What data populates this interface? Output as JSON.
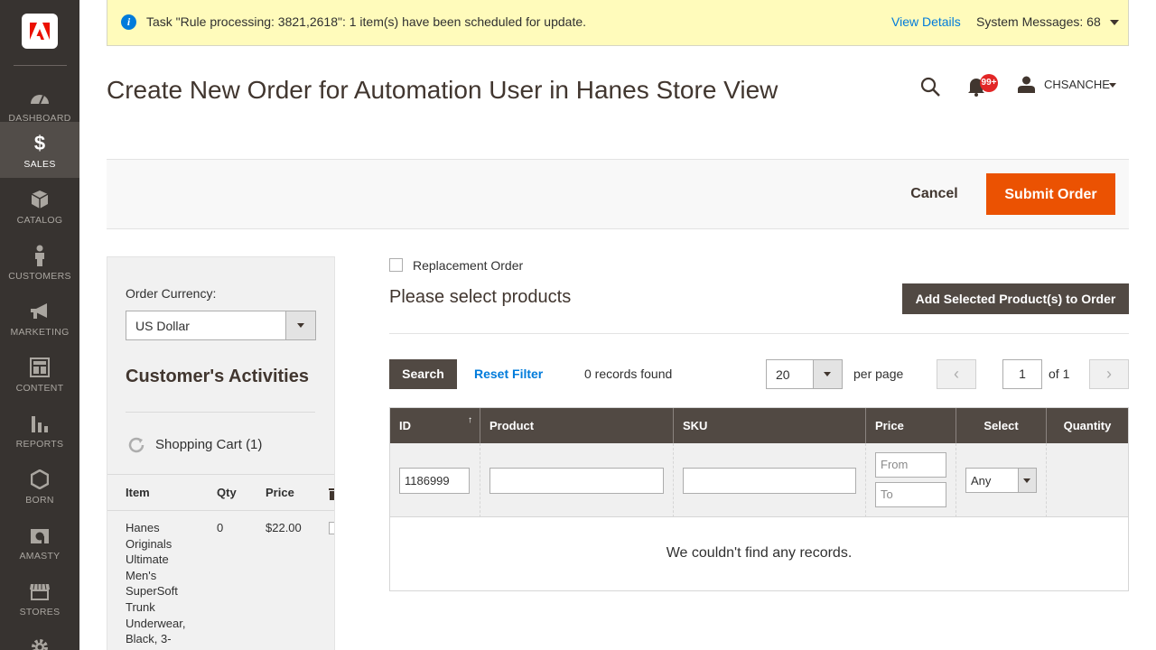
{
  "sidebar": {
    "logo_icon": "adobe-logo-icon",
    "items": [
      {
        "label": "DASHBOARD",
        "icon": "dashboard-gauge-icon"
      },
      {
        "label": "SALES",
        "icon": "dollar-icon",
        "active": true
      },
      {
        "label": "CATALOG",
        "icon": "box-icon"
      },
      {
        "label": "CUSTOMERS",
        "icon": "person-icon"
      },
      {
        "label": "MARKETING",
        "icon": "megaphone-icon"
      },
      {
        "label": "CONTENT",
        "icon": "layout-icon"
      },
      {
        "label": "REPORTS",
        "icon": "bar-chart-icon"
      },
      {
        "label": "BORN",
        "icon": "hexagon-icon"
      },
      {
        "label": "AMASTY",
        "icon": "amasty-icon"
      },
      {
        "label": "STORES",
        "icon": "store-icon"
      }
    ]
  },
  "message": {
    "text": "Task \"Rule processing: 3821,2618\": 1 item(s) have been scheduled for update.",
    "view_details": "View Details",
    "system_messages": "System Messages: 68"
  },
  "header": {
    "title": "Create New Order for Automation User in Hanes Store View",
    "notification_count": "99+",
    "username": "CHSANCHE"
  },
  "actions": {
    "cancel": "Cancel",
    "submit": "Submit Order"
  },
  "sidebar_panel": {
    "currency_label": "Order Currency:",
    "currency_value": "US Dollar",
    "activities_title": "Customer's Activities",
    "cart_label": "Shopping Cart (1)",
    "cart_headers": {
      "item": "Item",
      "qty": "Qty",
      "price": "Price"
    },
    "cart_rows": [
      {
        "item": "Hanes Originals Ultimate Men's SuperSoft Trunk Underwear, Black, 3-",
        "qty": "0",
        "price": "$22.00"
      }
    ]
  },
  "main": {
    "replacement_label": "Replacement Order",
    "select_title": "Please select products",
    "add_button": "Add Selected Product(s) to Order",
    "search_button": "Search",
    "reset_filter": "Reset Filter",
    "records_found": "0 records found",
    "per_page_value": "20",
    "per_page_label": "per page",
    "page_current": "1",
    "page_of": "of 1",
    "prev_symbol": "‹",
    "next_symbol": "›",
    "sort_symbol": "↑"
  },
  "grid": {
    "columns": [
      "ID",
      "Product",
      "SKU",
      "Price",
      "Select",
      "Quantity"
    ],
    "filters": {
      "id": "1186999",
      "product": "",
      "sku": "",
      "price_from_placeholder": "From",
      "price_to_placeholder": "To",
      "select_value": "Any"
    },
    "empty_message": "We couldn't find any records."
  },
  "colors": {
    "sidebar_bg": "#373330",
    "accent_orange": "#eb5202",
    "dark_button": "#514943",
    "link_blue": "#007bdb",
    "message_bg": "#fffbbb"
  }
}
